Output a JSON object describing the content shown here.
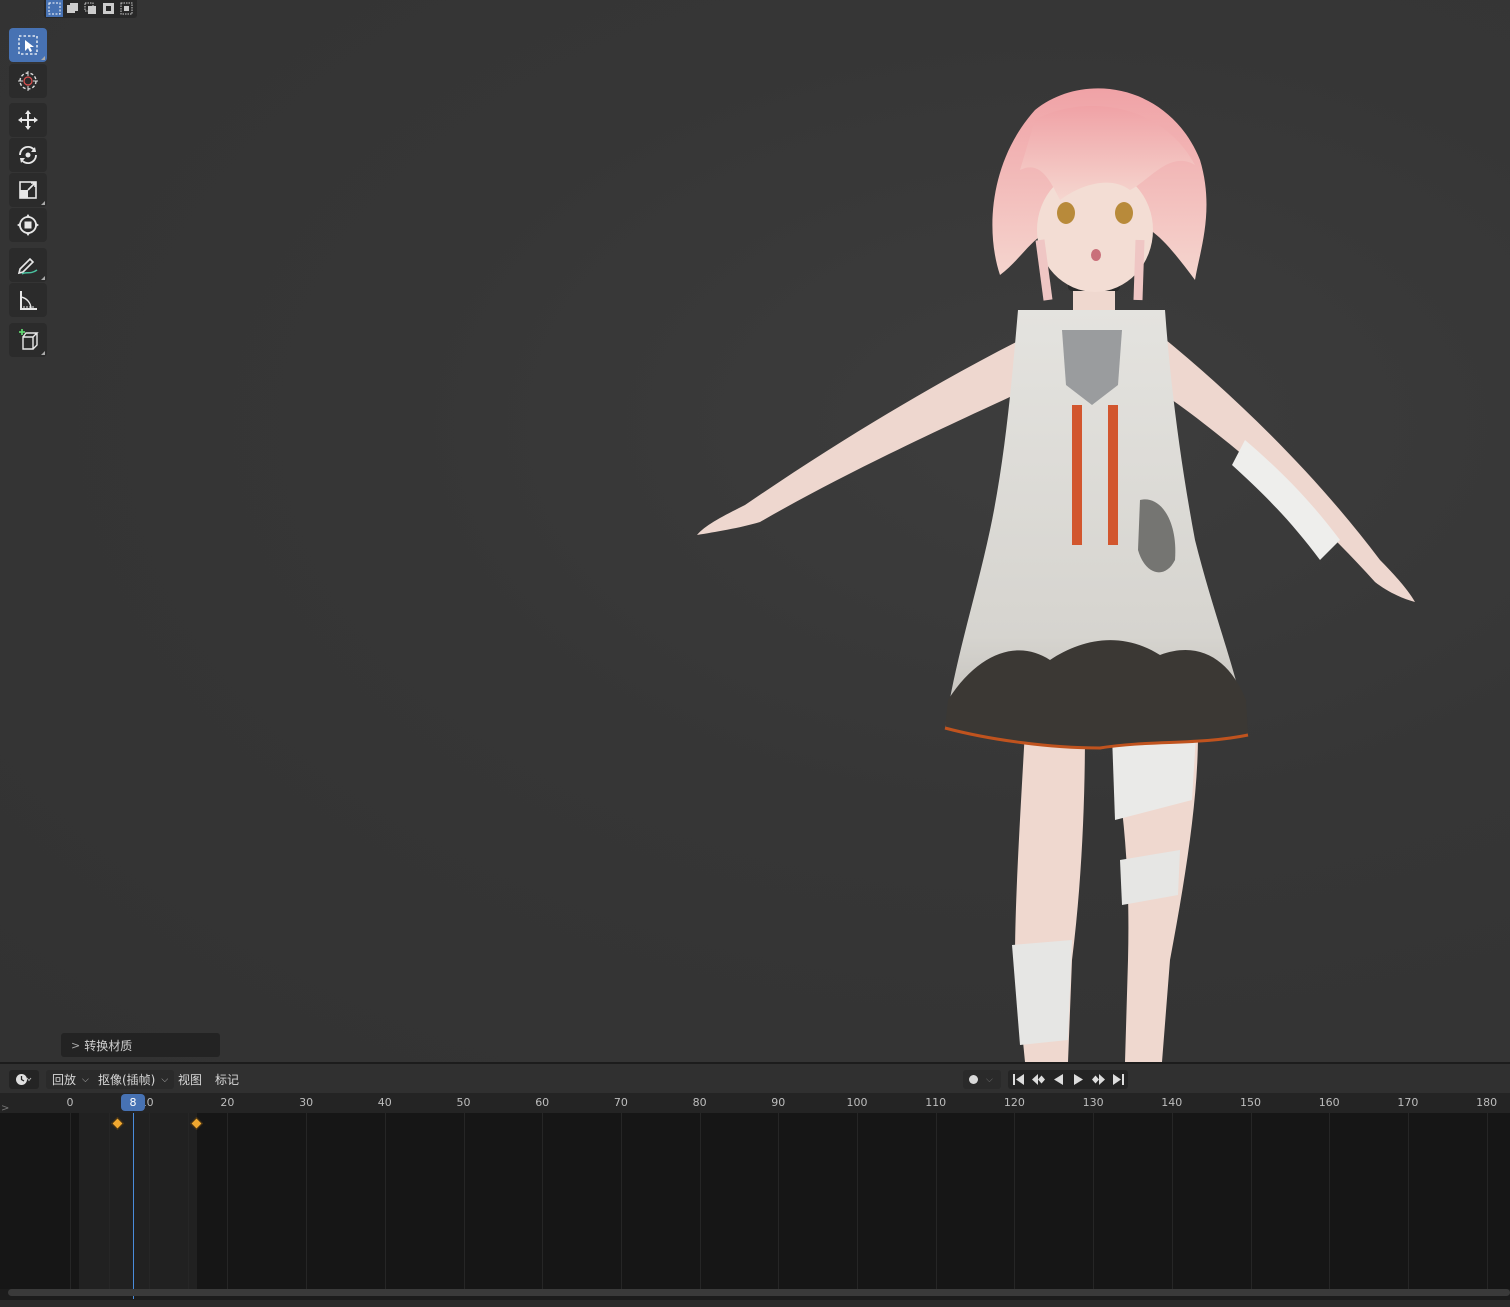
{
  "viewport": {
    "selection_modes": [
      "select-new-icon",
      "select-extend-icon",
      "select-subtract-icon",
      "select-invert-icon",
      "select-intersect-icon"
    ],
    "tools": [
      {
        "name": "select-box",
        "icon": "select-box-icon",
        "active": true
      },
      {
        "name": "cursor",
        "icon": "cursor-icon",
        "active": false
      },
      {
        "name": "move",
        "icon": "move-icon",
        "active": false
      },
      {
        "name": "rotate",
        "icon": "rotate-icon",
        "active": false
      },
      {
        "name": "scale",
        "icon": "scale-icon",
        "active": false
      },
      {
        "name": "transform",
        "icon": "transform-icon",
        "active": false
      },
      {
        "name": "annotate",
        "icon": "annotate-icon",
        "active": false
      },
      {
        "name": "measure",
        "icon": "measure-icon",
        "active": false
      },
      {
        "name": "add-cube",
        "icon": "add-cube-icon",
        "active": false
      }
    ],
    "last_operation_label": "转换材质"
  },
  "timeline_header": {
    "playback_label": "回放",
    "keying_label": "抠像(插帧)",
    "view_label": "视图",
    "marker_label": "标记"
  },
  "timeline": {
    "current_frame": "8",
    "ruler_labels": [
      "0",
      "20",
      "30",
      "40",
      "50",
      "60",
      "70",
      "80",
      "90",
      "100",
      "110",
      "120",
      "130",
      "140",
      "150",
      "160",
      "170",
      "180"
    ],
    "ten_label_partial": "10",
    "keyframes": [
      6,
      16
    ],
    "accent_color": "#4772b3",
    "keyframe_color": "#f0a830"
  }
}
